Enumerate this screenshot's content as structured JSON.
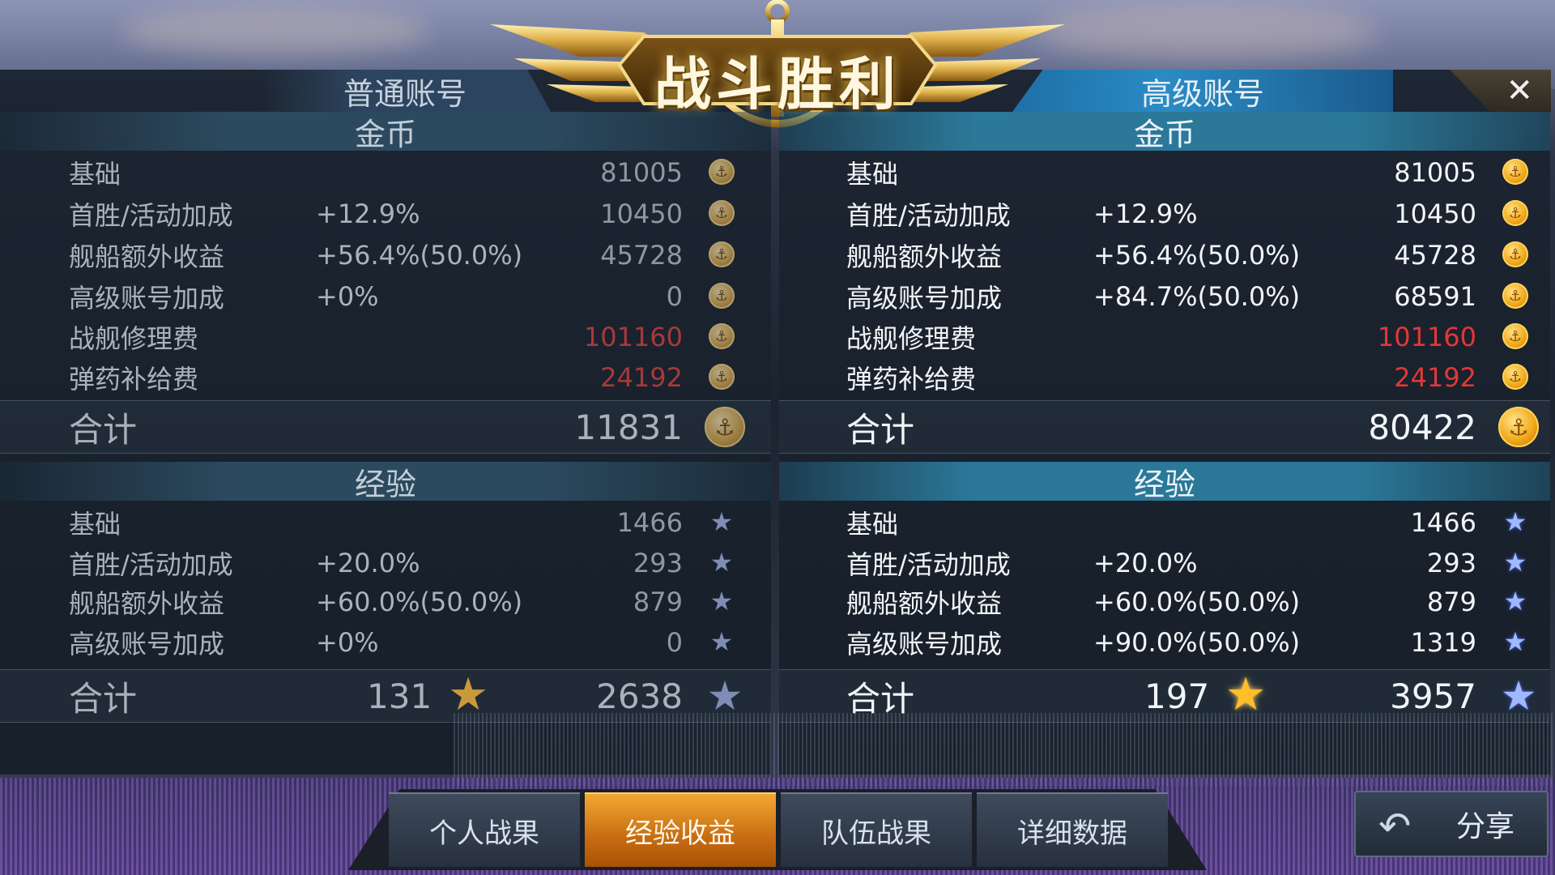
{
  "header": {
    "title": "战斗胜利",
    "normal_account_label": "普通账号",
    "premium_account_label": "高级账号",
    "close_glyph": "✕"
  },
  "colors": {
    "negative": "#e03838",
    "active_tab": "#f2a832",
    "premium_header": "#2a8bc4"
  },
  "icons": {
    "coin": "coin-icon",
    "exp_star": "exp-star-icon",
    "bonus_star": "bonus-star-icon",
    "share": "share-arrow-icon"
  },
  "normal": {
    "gold_title": "金币",
    "gold_rows": [
      {
        "label": "基础",
        "pct": "",
        "value": "81005"
      },
      {
        "label": "首胜/活动加成",
        "pct": "+12.9%",
        "value": "10450"
      },
      {
        "label": "舰船额外收益",
        "pct": "+56.4%(50.0%)",
        "value": "45728"
      },
      {
        "label": "高级账号加成",
        "pct": "+0%",
        "value": "0"
      },
      {
        "label": "战舰修理费",
        "pct": "",
        "value": "101160"
      },
      {
        "label": "弹药补给费",
        "pct": "",
        "value": "24192"
      }
    ],
    "gold_total_label": "合计",
    "gold_total": "11831",
    "exp_title": "经验",
    "exp_rows": [
      {
        "label": "基础",
        "pct": "",
        "value": "1466"
      },
      {
        "label": "首胜/活动加成",
        "pct": "+20.0%",
        "value": "293"
      },
      {
        "label": "舰船额外收益",
        "pct": "+60.0%(50.0%)",
        "value": "879"
      },
      {
        "label": "高级账号加成",
        "pct": "+0%",
        "value": "0"
      }
    ],
    "exp_total_label": "合计",
    "exp_bonus_total": "131",
    "exp_total": "2638"
  },
  "premium": {
    "gold_title": "金币",
    "gold_rows": [
      {
        "label": "基础",
        "pct": "",
        "value": "81005"
      },
      {
        "label": "首胜/活动加成",
        "pct": "+12.9%",
        "value": "10450"
      },
      {
        "label": "舰船额外收益",
        "pct": "+56.4%(50.0%)",
        "value": "45728"
      },
      {
        "label": "高级账号加成",
        "pct": "+84.7%(50.0%)",
        "value": "68591"
      },
      {
        "label": "战舰修理费",
        "pct": "",
        "value": "101160"
      },
      {
        "label": "弹药补给费",
        "pct": "",
        "value": "24192"
      }
    ],
    "gold_total_label": "合计",
    "gold_total": "80422",
    "exp_title": "经验",
    "exp_rows": [
      {
        "label": "基础",
        "pct": "",
        "value": "1466"
      },
      {
        "label": "首胜/活动加成",
        "pct": "+20.0%",
        "value": "293"
      },
      {
        "label": "舰船额外收益",
        "pct": "+60.0%(50.0%)",
        "value": "879"
      },
      {
        "label": "高级账号加成",
        "pct": "+90.0%(50.0%)",
        "value": "1319"
      }
    ],
    "exp_total_label": "合计",
    "exp_bonus_total": "197",
    "exp_total": "3957"
  },
  "tabs": [
    {
      "label": "个人战果",
      "active": false
    },
    {
      "label": "经验收益",
      "active": true
    },
    {
      "label": "队伍战果",
      "active": false
    },
    {
      "label": "详细数据",
      "active": false
    }
  ],
  "share_label": "分享"
}
